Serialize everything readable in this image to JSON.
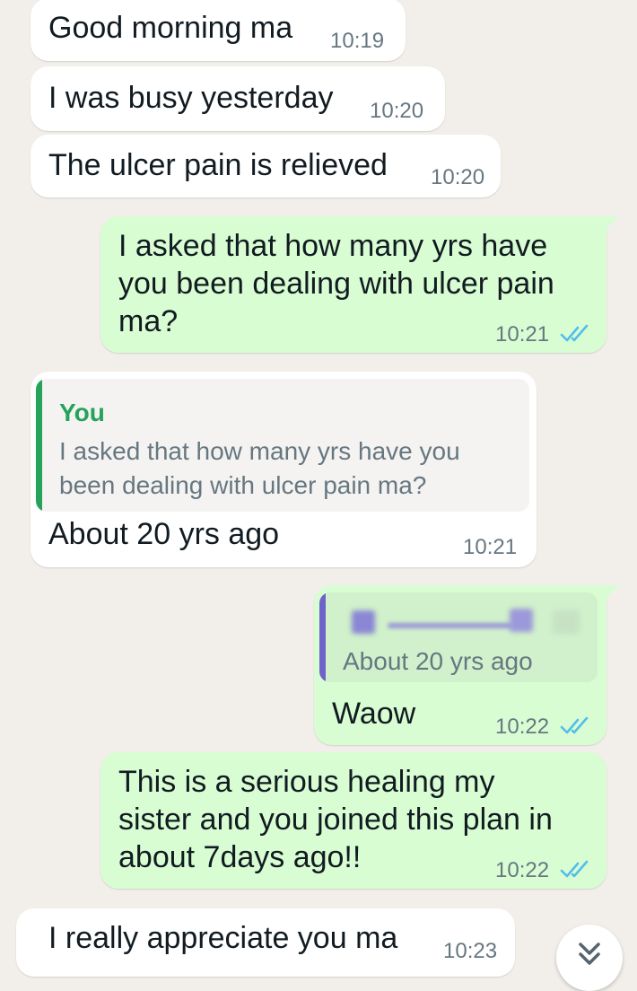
{
  "messages": [
    {
      "direction": "incoming",
      "text": "Good morning ma",
      "time": "10:19"
    },
    {
      "direction": "incoming",
      "text": "I was busy yesterday",
      "time": "10:20"
    },
    {
      "direction": "incoming",
      "text": "The ulcer pain is relieved",
      "time": "10:20"
    },
    {
      "direction": "outgoing",
      "lines": [
        "I asked that how many yrs have",
        "you been dealing with ulcer pain",
        "ma?"
      ],
      "time": "10:21",
      "status": "read"
    },
    {
      "direction": "incoming",
      "quote": {
        "author": "You",
        "lines": [
          "I asked that how many yrs have you",
          "been dealing with ulcer pain ma?"
        ]
      },
      "text": "About 20 yrs ago",
      "time": "10:21"
    },
    {
      "direction": "outgoing",
      "quote": {
        "author_redacted": true,
        "text": "About 20 yrs ago"
      },
      "text": "Waow",
      "time": "10:22",
      "status": "read"
    },
    {
      "direction": "outgoing",
      "lines": [
        "This is a serious healing my",
        "sister and you joined this plan in",
        "about 7days ago!!"
      ],
      "time": "10:22",
      "status": "read"
    },
    {
      "direction": "incoming",
      "text": "I really appreciate you ma",
      "time": "10:23"
    }
  ],
  "colors": {
    "background": "#f2efea",
    "incoming_bubble": "#ffffff",
    "outgoing_bubble": "#d9fdd3",
    "read_ticks": "#53bdeb",
    "quote_bar_you": "#25a35a",
    "quote_bar_other": "#6e63c9"
  },
  "icons": {
    "read_receipt": "double-check-icon",
    "scroll_down": "chevron-double-down-icon"
  }
}
